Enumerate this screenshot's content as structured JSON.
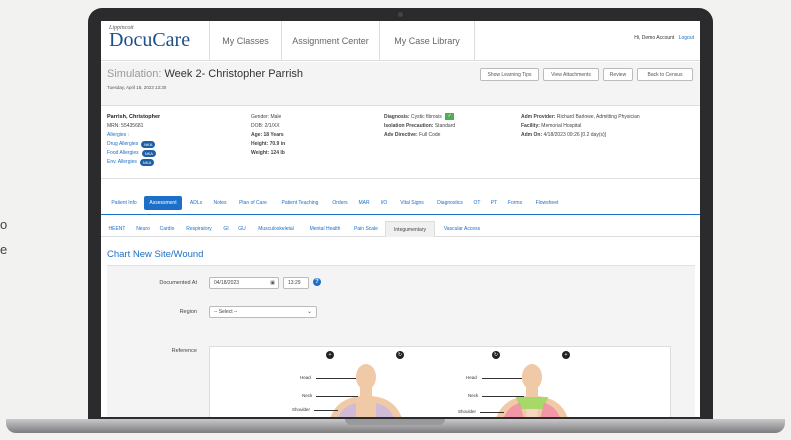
{
  "stray_text": [
    "o",
    "e"
  ],
  "header": {
    "logo_small": "Lippincott",
    "logo_big": "DocuCare",
    "nav": [
      "My Classes",
      "Assignment Center",
      "My Case Library"
    ],
    "greeting": "Hi, Demo Account",
    "logout": "Logout"
  },
  "simulation": {
    "prefix": "Simulation:",
    "title": "Week 2- Christopher Parrish",
    "date": "Tuesday, April 18, 2023 13:30",
    "buttons": [
      "Show Learning Tips",
      "View Attachments",
      "Review",
      "Back to Census"
    ]
  },
  "patient": {
    "name": "Parrish, Christopher",
    "mrn": "MRN: 55435681",
    "allergies_label": "Allergies :",
    "allergies": [
      {
        "label": "Drug Allergies",
        "badge": "NKA"
      },
      {
        "label": "Food Allergies",
        "badge": "NKA"
      },
      {
        "label": "Env. Allergies",
        "badge": "NKA"
      }
    ],
    "gender": "Gender: Male",
    "dob": "DOB: 2/1/XX",
    "age": "Age: 18 Years",
    "height": "Height: 70.9 in",
    "weight": "Weight: 124 lb",
    "diagnosis_label": "Diagnosis:",
    "diagnosis_value": "Cystic fibrosis",
    "isolation_label": "Isolation Precaution:",
    "isolation_value": "Standard",
    "directive_label": "Adv Directive:",
    "directive_value": "Full Code",
    "provider_label": "Adm Provider:",
    "provider_value": "Richard Barlowe, Admitting Physician",
    "facility_label": "Facility:",
    "facility_value": "Memorial Hospital",
    "admon_label": "Adm On:",
    "admon_value": "4/18/2023 09:26 [0.2 day(s)]"
  },
  "primary_tabs": [
    "Patient Info",
    "Assessment",
    "ADLs",
    "Notes",
    "Plan of Care",
    "Patient Teaching",
    "Orders",
    "MAR",
    "I/O",
    "Vital Signs",
    "Diagnostics",
    "OT",
    "PT",
    "Forms",
    "Flowsheet"
  ],
  "primary_active": "Assessment",
  "secondary_tabs": [
    "HEENT",
    "Neuro",
    "Cardio",
    "Respiratory",
    "GI",
    "GU",
    "Musculoskeletal",
    "Mental Health",
    "Pain Scale",
    "Integumentary",
    "Vascular Access"
  ],
  "secondary_active": "Integumentary",
  "form": {
    "title": "Chart New Site/Wound",
    "documented_label": "Documented At",
    "date_value": "04/18/2023",
    "time_value": "13:29",
    "region_label": "Region",
    "region_value": "-- Select --",
    "reference_label": "Reference",
    "body_labels": [
      "Head",
      "Neck",
      "Shoulder",
      "Head",
      "Neck",
      "Shoulder"
    ]
  },
  "colors": {
    "accent": "#1c70c7",
    "badge": "#1f5fa4",
    "frame": "#2b2b2d"
  }
}
